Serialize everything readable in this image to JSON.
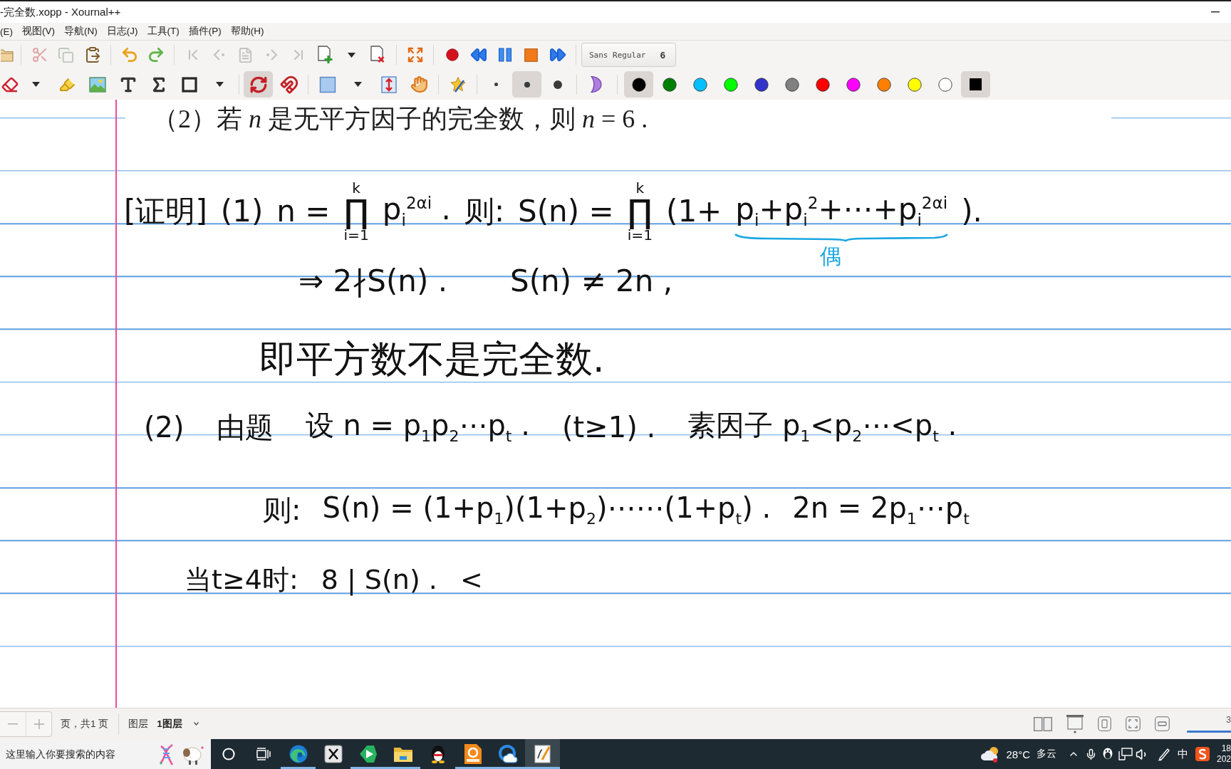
{
  "window": {
    "title": "-完全数.xopp - Xournal++"
  },
  "menu": [
    "(E)",
    "视图(V)",
    "导航(N)",
    "日志(J)",
    "工具(T)",
    "插件(P)",
    "帮助(H)"
  ],
  "main_toolbar": {
    "buttons": [
      {
        "disabled": false
      },
      {
        "disabled": true
      },
      {
        "disabled": true
      },
      {
        "disabled": false
      },
      {
        "disabled": false
      },
      {
        "disabled": false
      },
      {
        "disabled": true
      },
      {
        "disabled": true
      },
      {
        "disabled": true
      },
      {
        "disabled": true
      },
      {
        "disabled": true
      },
      {
        "disabled": false
      },
      {
        "disabled": false
      },
      {
        "disabled": false
      },
      {
        "disabled": false
      },
      {
        "disabled": false
      },
      {
        "disabled": false
      },
      {
        "disabled": false
      },
      {
        "disabled": false
      },
      {
        "disabled": false
      }
    ],
    "font": {
      "name": "Sans Regular",
      "size": "6"
    }
  },
  "tool_toolbar": {
    "tools": [
      {
        "selected": false
      },
      {
        "selected": false
      },
      {
        "selected": false
      },
      {
        "selected": false
      },
      {
        "selected": false
      },
      {
        "selected": false
      },
      {
        "selected": false
      },
      {
        "selected": false
      },
      {
        "selected": true
      },
      {
        "selected": false
      },
      {
        "selected": false
      },
      {
        "selected": false
      },
      {
        "selected": false
      },
      {
        "selected": false
      },
      {
        "selected": false
      }
    ],
    "line_widths": [
      {
        "selected": false
      },
      {
        "selected": true
      },
      {
        "selected": false
      }
    ],
    "colors": [
      {
        "color": "#000000",
        "selected": true
      },
      {
        "color": "#008000",
        "selected": false
      },
      {
        "color": "#00c0ff",
        "selected": false
      },
      {
        "color": "#00ff00",
        "selected": false
      },
      {
        "color": "#3333cc",
        "selected": false
      },
      {
        "color": "#808080",
        "selected": false
      },
      {
        "color": "#ff0000",
        "selected": false
      },
      {
        "color": "#ff00ff",
        "selected": false
      },
      {
        "color": "#ff8000",
        "selected": false
      },
      {
        "color": "#ffff00",
        "selected": false
      },
      {
        "color": "#ffffff",
        "selected": false
      }
    ],
    "custom_color": {
      "color": "#000000",
      "selected": true
    }
  },
  "page": {
    "problem_text": "（2）若 *n* 是无平方因子的完全数，则 *n* = 6 .",
    "lines": [
      {
        "parts": [
          {
            "kind": "text",
            "text": "[证明]"
          },
          {
            "kind": "text",
            "text": "(1)"
          },
          {
            "kind": "text",
            "text": "n ="
          },
          {
            "kind": "product",
            "symbol": "∏",
            "upper": "k",
            "lower": "i=1"
          },
          {
            "kind": "text",
            "text": "p$_{i}$$^{2αi}$ ."
          },
          {
            "kind": "text",
            "text": "则:"
          },
          {
            "kind": "text",
            "text": "S(n) ="
          },
          {
            "kind": "product",
            "symbol": "∏",
            "upper": "k",
            "lower": "i=1"
          },
          {
            "kind": "text",
            "text": "(1+"
          },
          {
            "kind": "braced",
            "text": "p$_{i}$+p$_{i}$$^{2}$+⋯+p$_{i}$$^{2αi}$",
            "note": "偶"
          },
          {
            "kind": "text",
            "text": ")."
          }
        ]
      },
      {
        "parts": [
          {
            "kind": "text",
            "text": "⇒ 2∤S(n) ."
          },
          {
            "kind": "text",
            "text": "S(n) ≠ 2n ,"
          }
        ]
      },
      {
        "parts": [
          {
            "kind": "text",
            "text": "即平方数不是完全数."
          }
        ]
      },
      {
        "parts": [
          {
            "kind": "text",
            "text": "(2)"
          },
          {
            "kind": "text",
            "text": "由题"
          },
          {
            "kind": "text",
            "text": "设 n = p$_{1}$p$_{2}$⋯p$_{t}$ ."
          },
          {
            "kind": "text",
            "text": "(t≥1) ."
          },
          {
            "kind": "text",
            "text": "素因子 p$_{1}$<p$_{2}$⋯<p$_{t}$ ."
          }
        ]
      },
      {
        "parts": [
          {
            "kind": "text",
            "text": "则:"
          },
          {
            "kind": "text",
            "text": "S(n) = (1+p$_{1}$)(1+p$_{2}$)⋯⋯(1+p$_{t}$) ."
          },
          {
            "kind": "text",
            "text": "2n = 2p$_{1}$⋯p$_{t}$"
          }
        ]
      },
      {
        "parts": [
          {
            "kind": "text",
            "text": "当t≥4时:"
          },
          {
            "kind": "text",
            "text": "8 | S(n) ."
          },
          {
            "kind": "text",
            "text": "<"
          }
        ]
      }
    ]
  },
  "status_bar": {
    "page_label": "页，共1 页",
    "layer_label": "图层",
    "layer": "1图层",
    "zoom_reading": "3",
    "zoom_slider": {
      "level": 1
    }
  },
  "taskbar": {
    "search": {
      "placeholder": "这里输入你要搜索的内容"
    },
    "apps": [
      {
        "running": true,
        "selected": false
      },
      {
        "running": false,
        "selected": false
      },
      {
        "running": true,
        "selected": false
      },
      {
        "running": true,
        "selected": false
      },
      {
        "running": false,
        "selected": false
      },
      {
        "running": true,
        "selected": false
      },
      {
        "running": true,
        "selected": false
      },
      {
        "running": true,
        "selected": true
      }
    ],
    "weather": {
      "temperature": "28°C",
      "condition": "多云"
    },
    "input_method": "中",
    "clock": [
      "18",
      "202"
    ]
  }
}
